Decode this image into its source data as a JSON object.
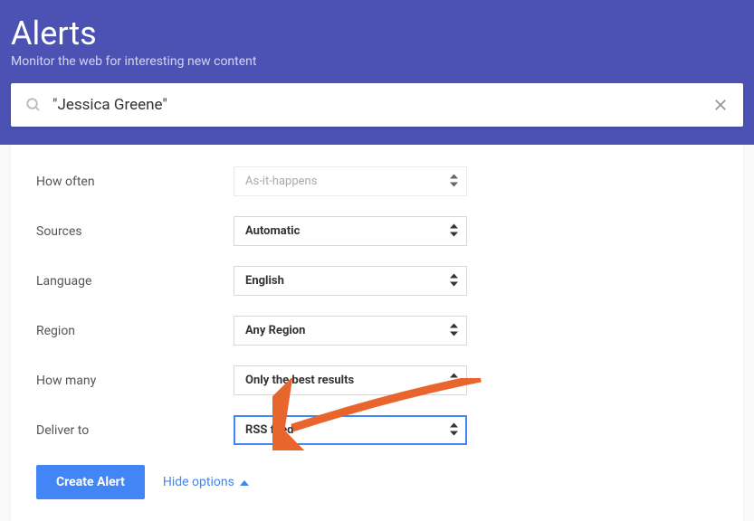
{
  "header": {
    "title": "Alerts",
    "subtitle": "Monitor the web for interesting new content"
  },
  "search": {
    "value": "\"Jessica Greene\""
  },
  "options": {
    "how_often": {
      "label": "How often",
      "value": "As-it-happens"
    },
    "sources": {
      "label": "Sources",
      "value": "Automatic"
    },
    "language": {
      "label": "Language",
      "value": "English"
    },
    "region": {
      "label": "Region",
      "value": "Any Region"
    },
    "how_many": {
      "label": "How many",
      "value": "Only the best results"
    },
    "deliver_to": {
      "label": "Deliver to",
      "value": "RSS feed"
    }
  },
  "footer": {
    "create_button": "Create Alert",
    "toggle_options": "Hide options"
  }
}
